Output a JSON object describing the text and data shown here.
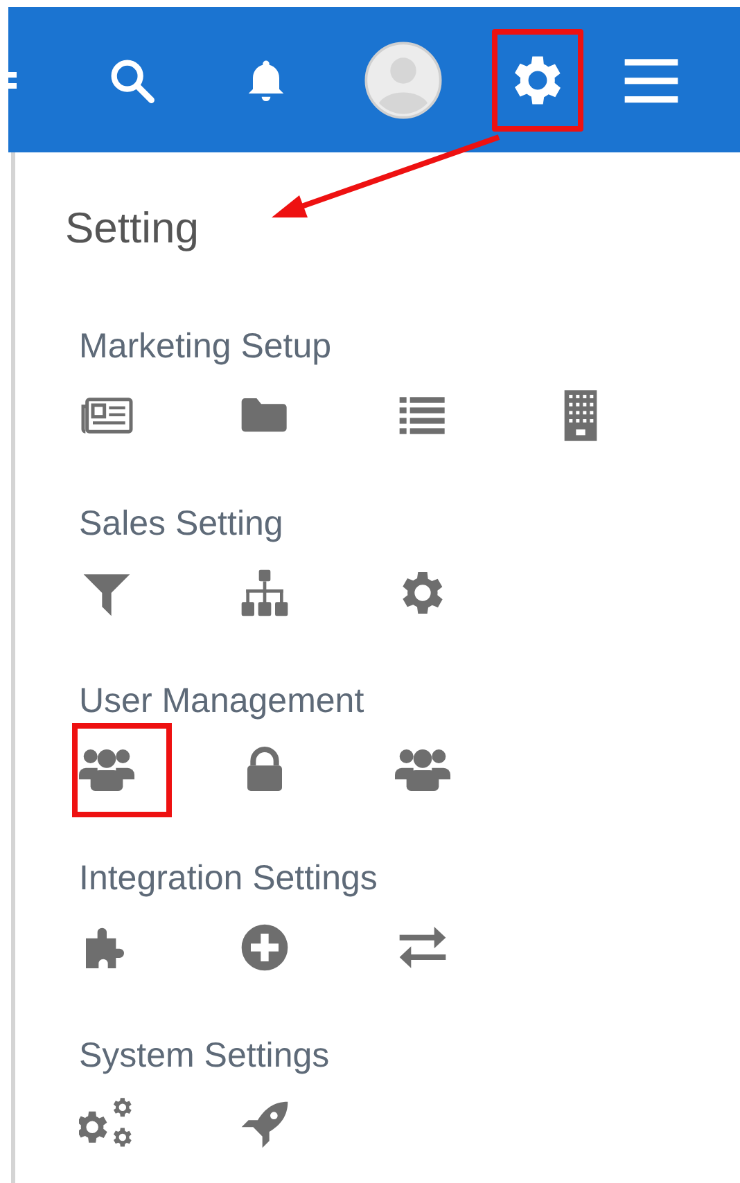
{
  "top_bar": {
    "icons": [
      {
        "kind": "partial"
      },
      {
        "kind": "search",
        "highlighted": false
      },
      {
        "kind": "bell",
        "highlighted": false
      },
      {
        "kind": "avatar",
        "highlighted": false
      },
      {
        "kind": "gear",
        "highlighted": true
      },
      {
        "kind": "menu",
        "highlighted": false
      }
    ]
  },
  "settings_panel": {
    "title": "Setting",
    "sections": [
      {
        "title": "Marketing Setup",
        "items": [
          {
            "kind": "newspaper",
            "highlighted": false
          },
          {
            "kind": "folder",
            "highlighted": false
          },
          {
            "kind": "list",
            "highlighted": false
          },
          {
            "kind": "building",
            "highlighted": false
          }
        ]
      },
      {
        "title": "Sales Setting",
        "items": [
          {
            "kind": "filter",
            "highlighted": false
          },
          {
            "kind": "sitemap",
            "highlighted": false
          },
          {
            "kind": "gear",
            "highlighted": false
          }
        ]
      },
      {
        "title": "User Management",
        "items": [
          {
            "kind": "users",
            "highlighted": true
          },
          {
            "kind": "lock",
            "highlighted": false
          },
          {
            "kind": "users",
            "highlighted": false
          }
        ]
      },
      {
        "title": "Integration Settings",
        "items": [
          {
            "kind": "puzzle",
            "highlighted": false
          },
          {
            "kind": "plus-circle",
            "highlighted": false
          },
          {
            "kind": "exchange",
            "highlighted": false
          }
        ]
      },
      {
        "title": "System Settings",
        "items": [
          {
            "kind": "gears",
            "highlighted": false
          },
          {
            "kind": "rocket",
            "highlighted": false
          }
        ]
      }
    ]
  }
}
